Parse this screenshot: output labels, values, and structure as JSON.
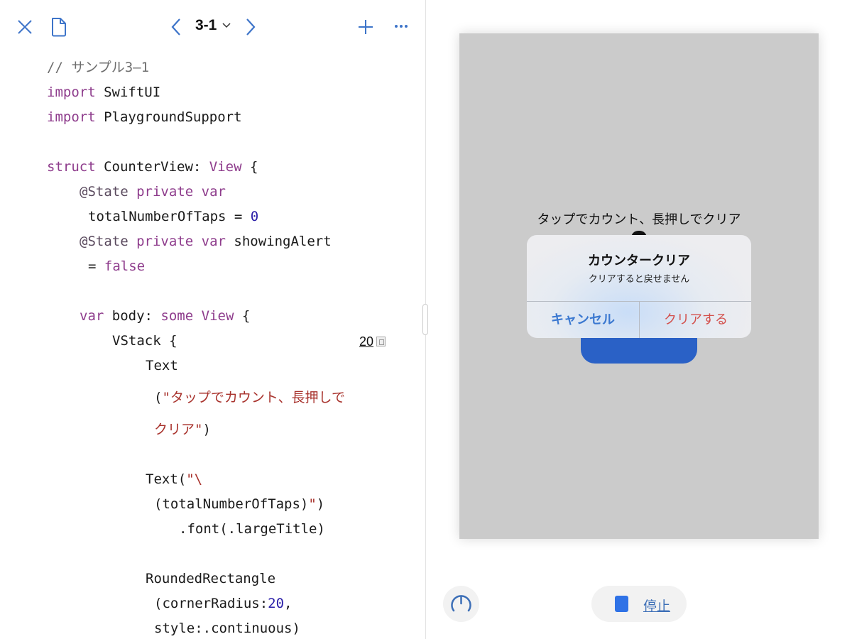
{
  "toolbar": {
    "title": "3-1",
    "icons": [
      "close-icon",
      "document-icon",
      "chevron-left-icon",
      "chevron-down-icon",
      "chevron-right-icon",
      "plus-icon",
      "more-icon"
    ]
  },
  "colors": {
    "accent": "#3d74c9",
    "keyword": "#8e3c8c",
    "string": "#a8322c",
    "number": "#2a1ea8",
    "comment": "#6e6e6e",
    "preview_bg": "#cbcbcb",
    "button_blue": "#2a61c6",
    "destructive": "#d3504c"
  },
  "code": [
    [
      [
        "cm",
        "// サンプル3–1"
      ]
    ],
    [
      [
        "kw",
        "import"
      ],
      [
        "pl",
        " SwiftUI"
      ]
    ],
    [
      [
        "kw",
        "import"
      ],
      [
        "pl",
        " PlaygroundSupport"
      ]
    ],
    [],
    [
      [
        "kw",
        "struct"
      ],
      [
        "pl",
        " CounterView: "
      ],
      [
        "kw",
        "View"
      ],
      [
        "pl",
        " {"
      ]
    ],
    [
      [
        "at",
        "@State"
      ],
      [
        "pl",
        " "
      ],
      [
        "kw",
        "private"
      ],
      [
        "pl",
        " "
      ],
      [
        "kw",
        "var"
      ]
    ],
    [
      [
        "pl",
        "totalNumberOfTaps = "
      ],
      [
        "num",
        "0"
      ]
    ],
    [
      [
        "at",
        "@State"
      ],
      [
        "pl",
        " "
      ],
      [
        "kw",
        "private"
      ],
      [
        "pl",
        " "
      ],
      [
        "kw",
        "var"
      ],
      [
        "pl",
        " showingAlert"
      ]
    ],
    [
      [
        "pl",
        "= "
      ],
      [
        "kw",
        "false"
      ]
    ],
    [],
    [
      [
        "kw",
        "var"
      ],
      [
        "pl",
        " body: "
      ],
      [
        "kw",
        "some"
      ],
      [
        "pl",
        " "
      ],
      [
        "kw",
        "View"
      ],
      [
        "pl",
        " {"
      ]
    ],
    [
      [
        "pl",
        "VStack {"
      ]
    ],
    [
      [
        "pl",
        "Text"
      ]
    ],
    [
      [
        "pl",
        "("
      ],
      [
        "str",
        "\"タップでカウント、長押しで"
      ]
    ],
    [
      [
        "str",
        "クリア\""
      ],
      [
        "pl",
        ")"
      ]
    ],
    [],
    [
      [
        "pl",
        "Text("
      ],
      [
        "str",
        "\"\\"
      ]
    ],
    [
      [
        "pl",
        "(totalNumberOfTaps)"
      ],
      [
        "str",
        "\""
      ],
      [
        "pl",
        ")"
      ]
    ],
    [
      [
        "pl",
        ".font(.largeTitle)"
      ]
    ],
    [],
    [
      [
        "pl",
        "RoundedRectangle"
      ]
    ],
    [
      [
        "pl",
        "(cornerRadius:"
      ],
      [
        "num",
        "20"
      ],
      [
        "pl",
        ","
      ]
    ],
    [
      [
        "pl",
        "style:.continuous)"
      ]
    ]
  ],
  "result_value": "20",
  "preview": {
    "prompt": "タップでカウント、長押しでクリア",
    "alert": {
      "title": "カウンタークリア",
      "message": "クリアすると戻せません",
      "cancel": "キャンセル",
      "confirm": "クリアする"
    }
  },
  "bottom": {
    "meter_icon": "speedometer-icon",
    "stop_label": "停止"
  }
}
